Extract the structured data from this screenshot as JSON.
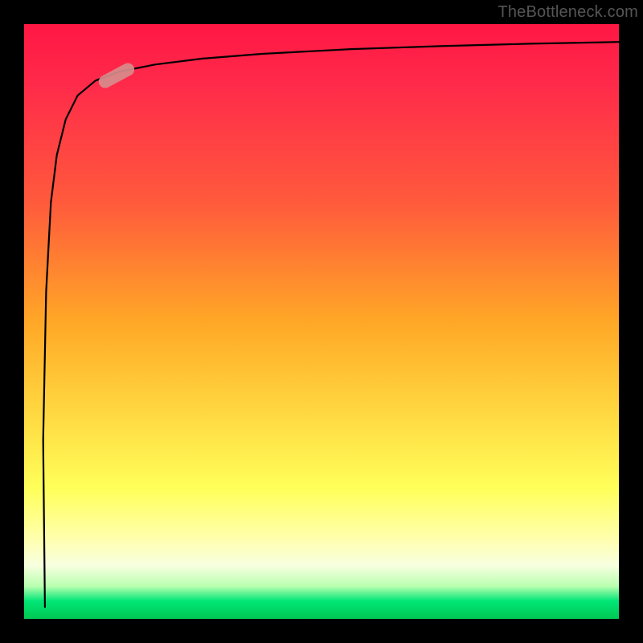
{
  "attribution": "TheBottleneck.com",
  "chart_data": {
    "type": "line",
    "title": "",
    "xlabel": "",
    "ylabel": "",
    "xlim": [
      0,
      100
    ],
    "ylim": [
      0,
      100
    ],
    "background_scale": {
      "orientation": "vertical",
      "stops": [
        {
          "pos": 0,
          "color": "#ff1744",
          "meaning": "high"
        },
        {
          "pos": 50,
          "color": "#ffa726",
          "meaning": "mid-high"
        },
        {
          "pos": 78,
          "color": "#ffff59",
          "meaning": "mid"
        },
        {
          "pos": 97,
          "color": "#00e676",
          "meaning": "low"
        }
      ]
    },
    "series": [
      {
        "name": "curve",
        "x": [
          3.5,
          3.2,
          3.7,
          4.5,
          5.5,
          7,
          9,
          12,
          16,
          22,
          30,
          40,
          55,
          70,
          85,
          100
        ],
        "y": [
          2,
          30,
          55,
          70,
          78,
          84,
          88,
          90.5,
          92,
          93.2,
          94.2,
          95,
          95.8,
          96.3,
          96.7,
          97
        ]
      }
    ],
    "marker": {
      "x": 15.5,
      "y": 91.3,
      "angle_deg": -28
    }
  }
}
